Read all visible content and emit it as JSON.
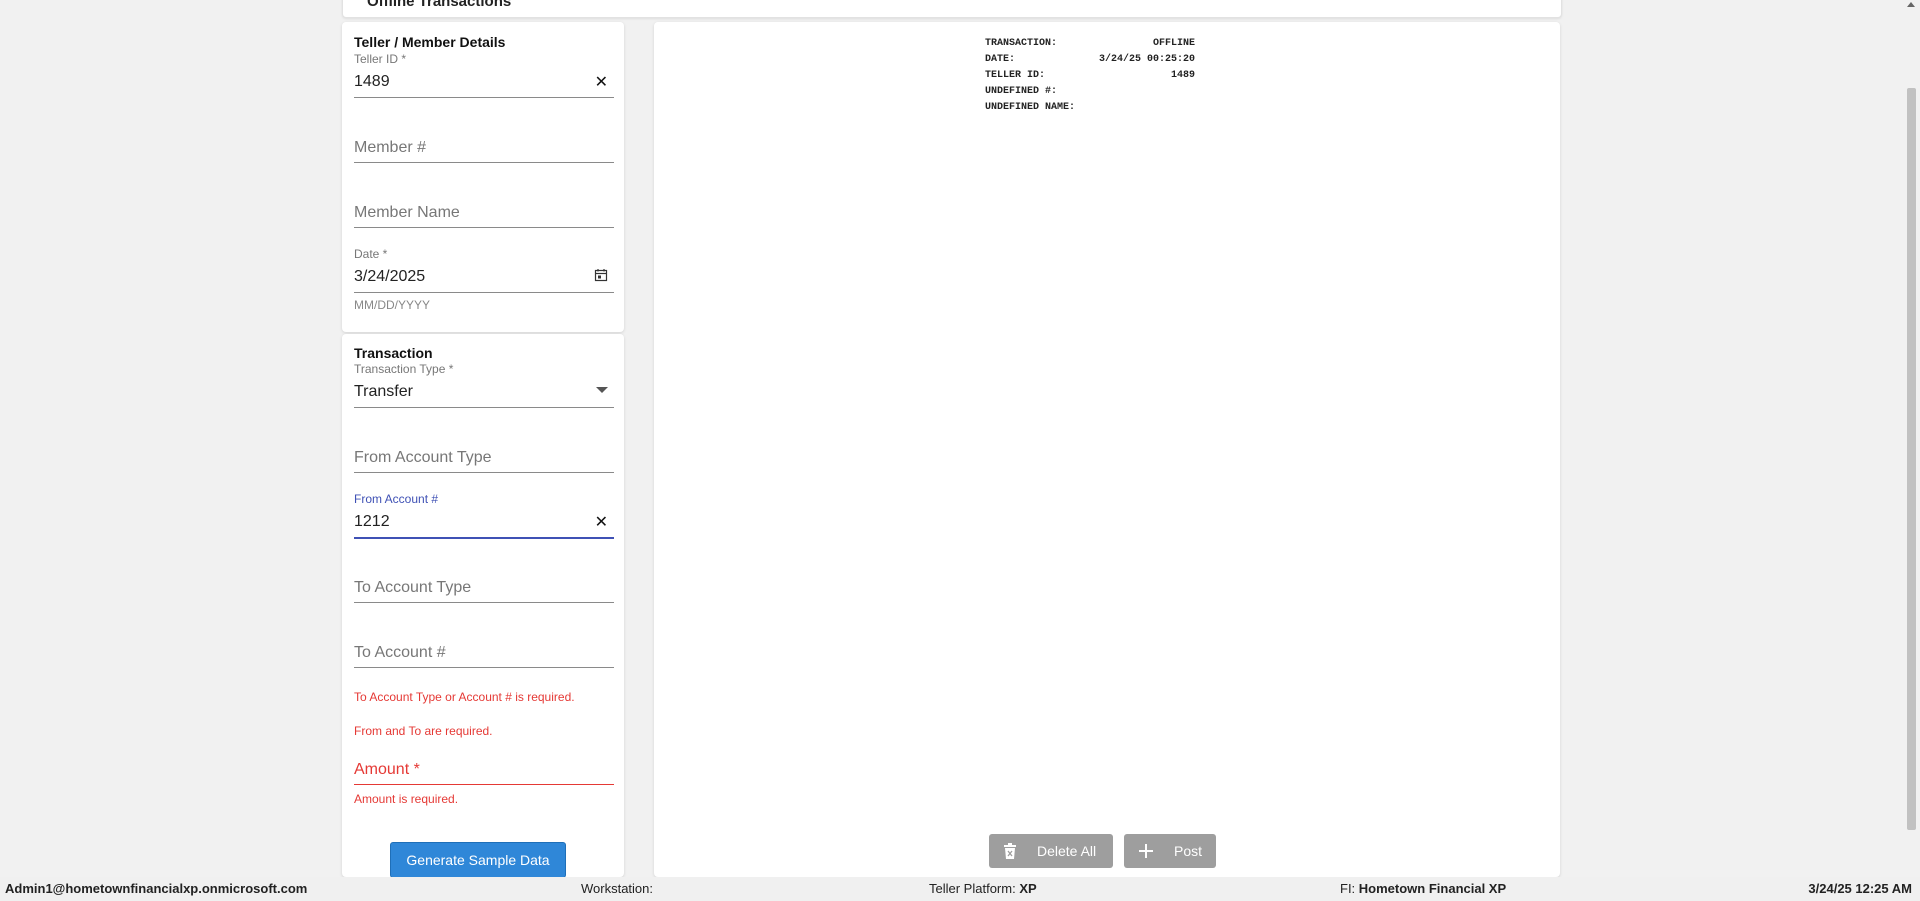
{
  "page": {
    "title": "Offline Transactions"
  },
  "member_section": {
    "title": "Teller / Member Details",
    "teller_id": {
      "label": "Teller ID *",
      "value": "1489"
    },
    "member_number": {
      "placeholder": "Member #"
    },
    "member_name": {
      "placeholder": "Member Name"
    },
    "date": {
      "label": "Date *",
      "value": "3/24/2025",
      "hint": "MM/DD/YYYY"
    }
  },
  "transaction_section": {
    "title": "Transaction",
    "transaction_type": {
      "label": "Transaction Type *",
      "value": "Transfer"
    },
    "from_account_type": {
      "placeholder": "From Account Type"
    },
    "from_account_number": {
      "label": "From Account #",
      "value": "1212"
    },
    "to_account_type": {
      "placeholder": "To Account Type"
    },
    "to_account_number": {
      "placeholder": "To Account #"
    },
    "errors": [
      "To Account Type or Account # is required.",
      "From and To are required."
    ],
    "amount": {
      "placeholder": "Amount *",
      "error": "Amount is required."
    },
    "generate_button": "Generate Sample Data"
  },
  "receipt": {
    "rows": [
      {
        "key": "TRANSACTION:",
        "value": "OFFLINE"
      },
      {
        "key": "DATE:",
        "value": "3/24/25 00:25:20"
      },
      {
        "key": "TELLER ID:",
        "value": "1489"
      },
      {
        "key": "UNDEFINED #:",
        "value": ""
      },
      {
        "key": "UNDEFINED NAME:",
        "value": ""
      }
    ]
  },
  "actions": {
    "delete_all": "Delete All",
    "post": "Post"
  },
  "status_bar": {
    "user": "Admin1@hometownfinancialxp.onmicrosoft.com",
    "workstation_label": "Workstation:",
    "workstation_value": "",
    "platform_label": "Teller Platform:",
    "platform_value": "XP",
    "fi_label": "FI:",
    "fi_value": "Hometown Financial XP",
    "datetime": "3/24/25 12:25 AM"
  },
  "colors": {
    "accent": "#3f51b5",
    "error": "#e53935",
    "primary_button": "#2f87d8",
    "disabled_button": "#9e9e9e"
  },
  "icons": {
    "clear": "close-icon",
    "date": "calendar-icon",
    "dropdown": "dropdown-arrow-icon",
    "delete": "trash-icon",
    "post": "plus-icon"
  }
}
